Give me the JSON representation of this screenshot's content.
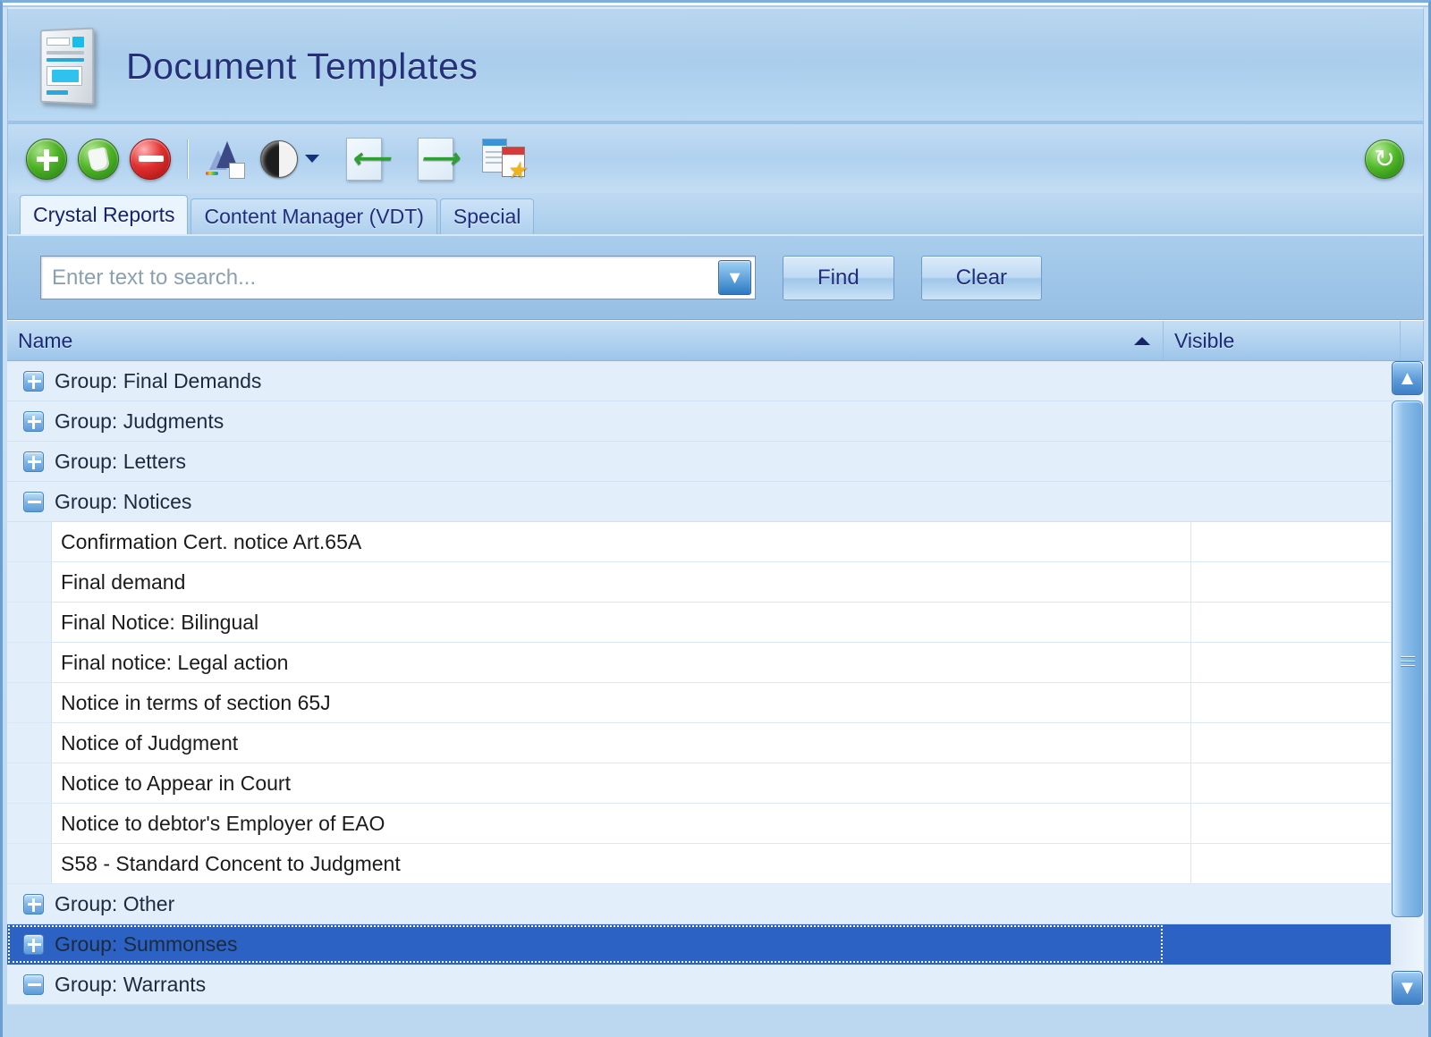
{
  "window": {
    "title": "Document Templates"
  },
  "toolbar": {
    "buttons": [
      {
        "name": "add",
        "icon": "add-circle-icon",
        "tooltip": "Add"
      },
      {
        "name": "edit",
        "icon": "edit-circle-icon",
        "tooltip": "Edit"
      },
      {
        "name": "delete",
        "icon": "delete-circle-icon",
        "tooltip": "Delete"
      },
      {
        "name": "design",
        "icon": "design-report-icon",
        "tooltip": "Design"
      },
      {
        "name": "preview",
        "icon": "contrast-icon",
        "tooltip": "Preview"
      },
      {
        "name": "import",
        "icon": "import-page-icon",
        "tooltip": "Import"
      },
      {
        "name": "export",
        "icon": "export-page-icon",
        "tooltip": "Export"
      },
      {
        "name": "favourite",
        "icon": "document-star-icon",
        "tooltip": "Set Default"
      }
    ],
    "refresh": {
      "icon": "refresh-icon",
      "tooltip": "Refresh"
    }
  },
  "tabs": [
    {
      "label": "Crystal Reports",
      "active": true
    },
    {
      "label": "Content Manager (VDT)",
      "active": false
    },
    {
      "label": "Special",
      "active": false
    }
  ],
  "search": {
    "placeholder": "Enter text to search...",
    "value": "",
    "dropdown_icon": "chevron-down-icon",
    "find_label": "Find",
    "clear_label": "Clear"
  },
  "grid": {
    "columns": [
      {
        "label": "Name",
        "sorted": "asc",
        "sort_icon": "sort-ascending-icon"
      },
      {
        "label": "Visible"
      },
      {
        "label": ""
      }
    ],
    "rows": [
      {
        "type": "group",
        "expanded": false,
        "label": "Group: Final Demands",
        "selected": false
      },
      {
        "type": "group",
        "expanded": false,
        "label": "Group: Judgments",
        "selected": false
      },
      {
        "type": "group",
        "expanded": false,
        "label": "Group: Letters",
        "selected": false
      },
      {
        "type": "group",
        "expanded": true,
        "label": "Group: Notices",
        "selected": false
      },
      {
        "type": "child",
        "label": "Confirmation Cert. notice Art.65A",
        "visible": ""
      },
      {
        "type": "child",
        "label": "Final demand",
        "visible": ""
      },
      {
        "type": "child",
        "label": "Final Notice: Bilingual",
        "visible": ""
      },
      {
        "type": "child",
        "label": "Final notice: Legal action",
        "visible": ""
      },
      {
        "type": "child",
        "label": "Notice in terms of section 65J",
        "visible": ""
      },
      {
        "type": "child",
        "label": "Notice of Judgment",
        "visible": ""
      },
      {
        "type": "child",
        "label": "Notice to Appear in Court",
        "visible": ""
      },
      {
        "type": "child",
        "label": "Notice to debtor's Employer of EAO",
        "visible": ""
      },
      {
        "type": "child",
        "label": "S58 - Standard Concent to Judgment",
        "visible": ""
      },
      {
        "type": "group",
        "expanded": false,
        "label": "Group: Other",
        "selected": false
      },
      {
        "type": "group",
        "expanded": false,
        "label": "Group: Summonses",
        "selected": true
      },
      {
        "type": "group",
        "expanded": true,
        "label": "Group: Warrants",
        "selected": false
      }
    ]
  },
  "scrollbar": {
    "up_icon": "chevron-up-icon",
    "down_icon": "chevron-down-icon",
    "grip_icon": "grip-icon"
  },
  "colors": {
    "accent": "#2b62c4",
    "title_text": "#24307a",
    "header_band": "#a9cdec",
    "group_row": "#e3eefb",
    "child_row": "#ffffff"
  }
}
